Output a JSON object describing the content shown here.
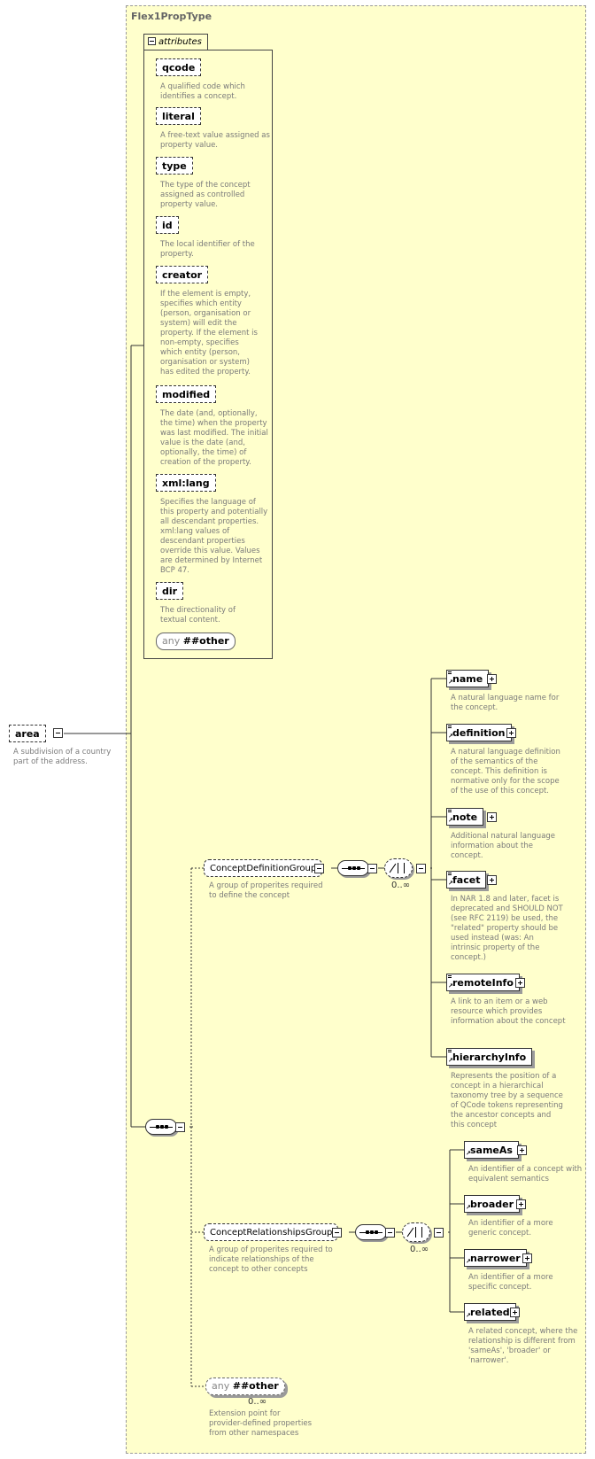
{
  "type_name": "Flex1PropType",
  "root": {
    "name": "area",
    "doc": "A subdivision of a country part of the address."
  },
  "attributes": {
    "tab_label": "attributes",
    "items": [
      {
        "name": "qcode",
        "doc": "A qualified code which identifies a concept."
      },
      {
        "name": "literal",
        "doc": "A free-text value assigned as property value."
      },
      {
        "name": "type",
        "doc": "The type of the concept assigned as controlled property value."
      },
      {
        "name": "id",
        "doc": "The local identifier of the property."
      },
      {
        "name": "creator",
        "doc": "If the element is empty, specifies which entity (person, organisation or system) will edit the property. If the element is non-empty, specifies which entity (person, organisation or system) has edited the property."
      },
      {
        "name": "modified",
        "doc": "The date (and, optionally, the time) when the property was last modified. The initial value is the date (and, optionally, the time) of creation of the property."
      },
      {
        "name": "xml:lang",
        "doc": "Specifies the language of this property and potentially all descendant properties. xml:lang values of descendant properties override this value. Values are determined by Internet BCP 47."
      },
      {
        "name": "dir",
        "doc": "The directionality of textual content."
      }
    ],
    "any_other": {
      "keyword": "any",
      "namespace": "##other"
    }
  },
  "concept_definition_group": {
    "name": "ConceptDefinitionGroup",
    "doc": "A group of properites required to define the concept",
    "occurrence": "0..∞",
    "elements": [
      {
        "name": "name",
        "doc": "A natural language name for the concept."
      },
      {
        "name": "definition",
        "doc": "A natural language definition of the semantics of the concept. This definition is normative only for the scope of the use of this concept."
      },
      {
        "name": "note",
        "doc": "Additional natural language information about the concept."
      },
      {
        "name": "facet",
        "doc": "In NAR 1.8 and later, facet is deprecated and SHOULD NOT (see RFC 2119) be used, the \"related\" property should be used instead (was: An intrinsic property of the concept.)"
      },
      {
        "name": "remoteInfo",
        "doc": "A link to an item or a web resource which provides information about the concept"
      },
      {
        "name": "hierarchyInfo",
        "doc": "Represents the position of a concept in a hierarchical taxonomy tree by a sequence of QCode tokens representing the ancestor concepts and this concept"
      }
    ]
  },
  "concept_relationships_group": {
    "name": "ConceptRelationshipsGroup",
    "doc": "A group of properites required to indicate relationships of the concept to other concepts",
    "occurrence": "0..∞",
    "elements": [
      {
        "name": "sameAs",
        "doc": "An identifier of a concept with equivalent semantics"
      },
      {
        "name": "broader",
        "doc": "An identifier of a more generic concept."
      },
      {
        "name": "narrower",
        "doc": "An identifier of a more specific concept."
      },
      {
        "name": "related",
        "doc": "A related concept, where the relationship is different from 'sameAs', 'broader' or 'narrower'."
      }
    ]
  },
  "extension_any": {
    "keyword": "any",
    "namespace": "##other",
    "occurrence": "0..∞",
    "doc": "Extension point for provider-defined properties from other namespaces"
  }
}
